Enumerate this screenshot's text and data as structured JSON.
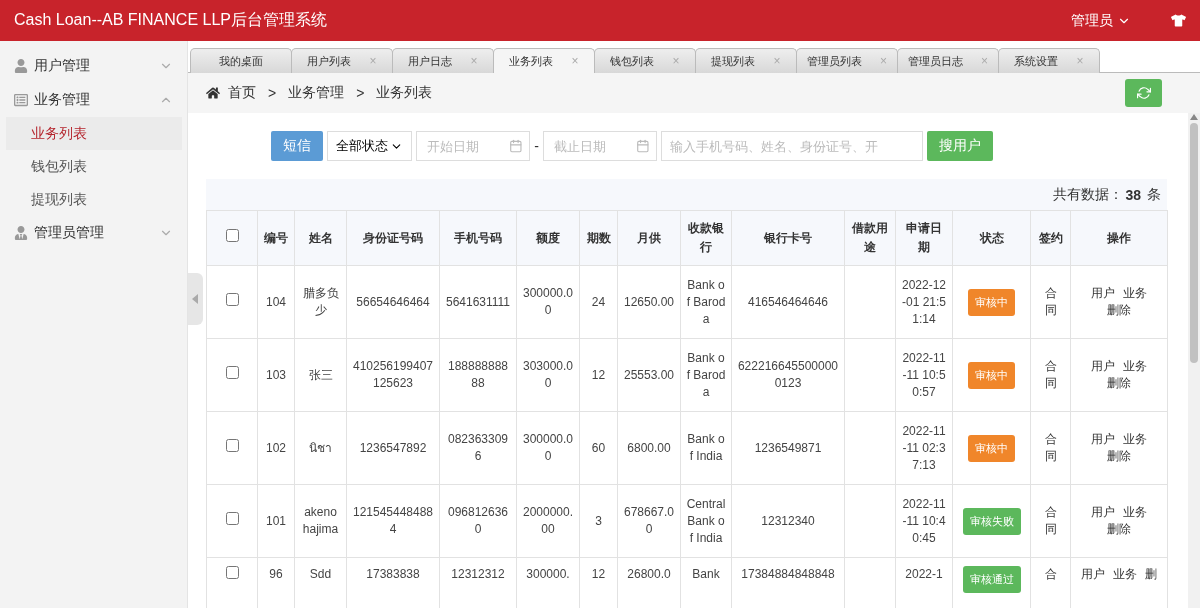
{
  "header": {
    "title": "Cash Loan--AB FINANCE LLP后台管理系统",
    "user": "管理员"
  },
  "sidebar": {
    "groups": [
      {
        "label": "用户管理",
        "expanded": false
      },
      {
        "label": "业务管理",
        "expanded": true,
        "items": [
          {
            "label": "业务列表",
            "selected": true
          },
          {
            "label": "钱包列表",
            "selected": false
          },
          {
            "label": "提现列表",
            "selected": false
          }
        ]
      },
      {
        "label": "管理员管理",
        "expanded": false
      }
    ]
  },
  "tabs": [
    {
      "label": "我的桌面",
      "selected": false
    },
    {
      "label": "用户列表",
      "selected": false,
      "close": "×"
    },
    {
      "label": "用户日志",
      "selected": false,
      "close": "×"
    },
    {
      "label": "业务列表",
      "selected": true,
      "close": "×"
    },
    {
      "label": "钱包列表",
      "selected": false,
      "close": "×"
    },
    {
      "label": "提现列表",
      "selected": false,
      "close": "×"
    },
    {
      "label": "管理员列表",
      "selected": false,
      "close": "×"
    },
    {
      "label": "管理员日志",
      "selected": false,
      "close": "×"
    },
    {
      "label": "系统设置",
      "selected": false,
      "close": "×"
    }
  ],
  "breadcrumb": [
    "首页",
    "业务管理",
    "业务列表"
  ],
  "breadcrumb_separator": ">",
  "toolbar": {
    "sms_button": "短信",
    "status_select": "全部状态",
    "start_date": {
      "placeholder": "开始日期"
    },
    "date_separator": "-",
    "end_date": {
      "placeholder": "截止日期"
    },
    "search": {
      "placeholder": "输入手机号码、姓名、身份证号、开"
    },
    "search_button": "搜用户"
  },
  "summary": {
    "label": "共有数据：",
    "count": "38",
    "unit": "条"
  },
  "table": {
    "select_all_checked": false,
    "columns": [
      "编号",
      "姓名",
      "身份证号码",
      "手机号码",
      "额度",
      "期数",
      "月供",
      "收款银行",
      "银行卡号",
      "借款用途",
      "申请日期",
      "状态",
      "签约",
      "操作"
    ],
    "rows": [
      {
        "checked": false,
        "id": "104",
        "name": "腊多负少",
        "id_card": "56654646464",
        "phone": "5641631111",
        "amount": "300000.00",
        "term": "24",
        "monthly": "12650.00",
        "bank": "Bank of Baroda",
        "card": "416546464646",
        "date": "2022-12-01 21:51:14",
        "status": {
          "label": "审核中",
          "kind": "pending"
        },
        "sign": "合同",
        "actions": [
          "用户",
          "业务",
          "删除"
        ]
      },
      {
        "checked": false,
        "id": "103",
        "name": "张三",
        "id_card": "410256199407125623",
        "phone": "18888888888",
        "amount": "303000.00",
        "term": "12",
        "monthly": "25553.00",
        "bank": "Bank of Baroda",
        "card": "6222166455000000123",
        "date": "2022-11-11 10:50:57",
        "status": {
          "label": "审核中",
          "kind": "pending"
        },
        "sign": "合同",
        "actions": [
          "用户",
          "业务",
          "删除"
        ]
      },
      {
        "checked": false,
        "id": "102",
        "name": "นิชา",
        "id_card": "1236547892",
        "phone": "0823633096",
        "amount": "300000.00",
        "term": "60",
        "monthly": "6800.00",
        "bank": "Bank of India",
        "card": "1236549871",
        "date": "2022-11-11 02:37:13",
        "status": {
          "label": "审核中",
          "kind": "pending"
        },
        "sign": "合同",
        "actions": [
          "用户",
          "业务",
          "删除"
        ]
      },
      {
        "checked": false,
        "id": "101",
        "name": "akeno hajima",
        "id_card": "1215454484884",
        "phone": "0968126360",
        "amount": "2000000.00",
        "term": "3",
        "monthly": "678667.00",
        "bank": "Central Bank of India",
        "card": "12312340",
        "date": "2022-11-11 10:40:45",
        "status": {
          "label": "审核失败",
          "kind": "approved"
        },
        "sign": "合同",
        "actions": [
          "用户",
          "业务",
          "删除"
        ]
      },
      {
        "checked": false,
        "id": "96",
        "name": "Sdd",
        "id_card": "17383838",
        "phone": "12312312",
        "amount": "300000.",
        "term": "12",
        "monthly": "26800.0",
        "bank": "Bank",
        "card": "17384884848848",
        "date": "2022-1",
        "status": {
          "label": "审核通过",
          "kind": "approved"
        },
        "sign": "合",
        "actions": [
          "用户",
          "业务",
          "删"
        ]
      }
    ]
  }
}
